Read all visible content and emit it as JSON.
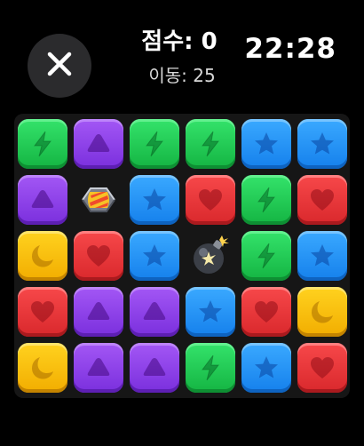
{
  "header": {
    "close_icon": "close-icon",
    "score_label": "점수:",
    "score_value": "0",
    "moves_label": "이동:",
    "moves_value": "25",
    "clock": "22:28"
  },
  "board": {
    "rows": [
      [
        "green-bolt",
        "purple-triangle",
        "green-bolt",
        "green-bolt",
        "blue-star",
        "blue-star"
      ],
      [
        "purple-triangle",
        "striped-candy",
        "blue-star",
        "red-heart",
        "green-bolt",
        "red-heart"
      ],
      [
        "yellow-moon",
        "red-heart",
        "blue-star",
        "bomb",
        "green-bolt",
        "blue-star"
      ],
      [
        "red-heart",
        "purple-triangle",
        "purple-triangle",
        "blue-star",
        "red-heart",
        "yellow-moon"
      ],
      [
        "yellow-moon",
        "purple-triangle",
        "purple-triangle",
        "green-bolt",
        "blue-star",
        "red-heart"
      ]
    ]
  },
  "colors": {
    "background": "#000000",
    "green": "#1fc955",
    "purple": "#8c3fe8",
    "blue": "#2394f6",
    "red": "#e8363a",
    "yellow": "#fbc110"
  }
}
